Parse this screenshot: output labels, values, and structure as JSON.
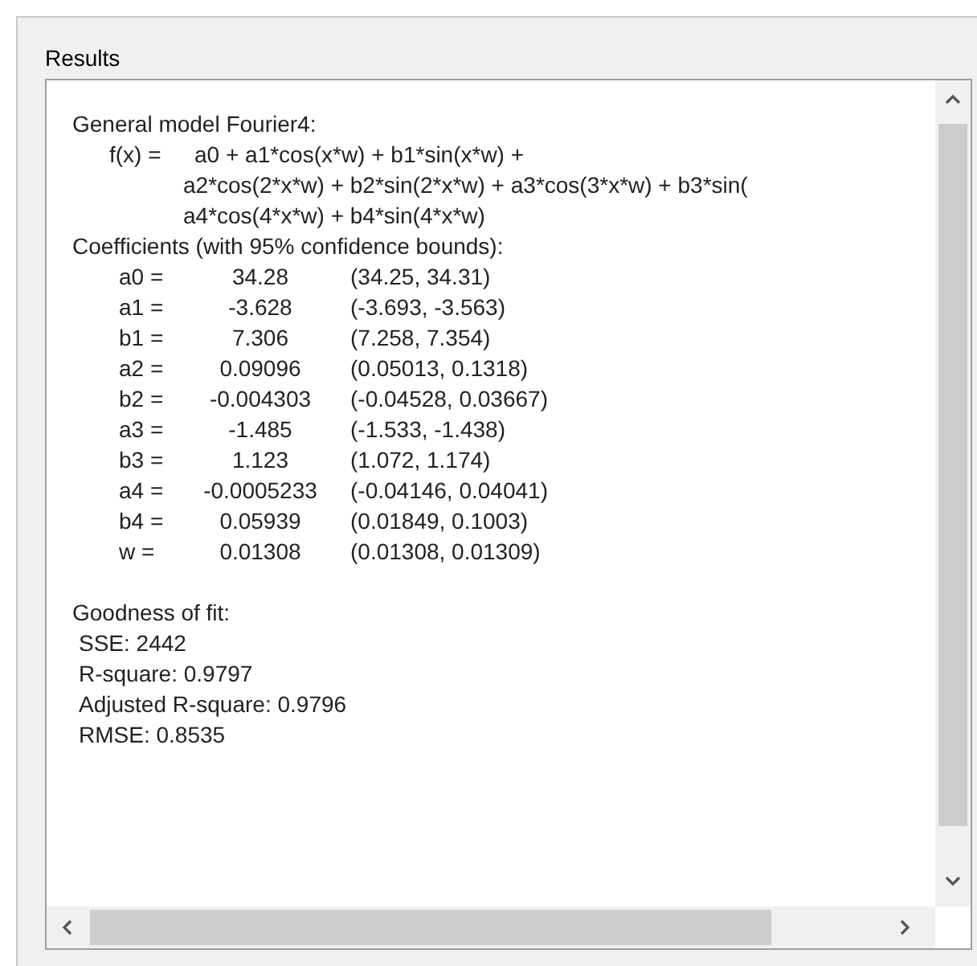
{
  "panel": {
    "title": "Results"
  },
  "results": {
    "model_heading": "General model Fourier4:",
    "formula_lhs": "f(x) =",
    "formula_lines": [
      "a0 + a1*cos(x*w) + b1*sin(x*w) +",
      "a2*cos(2*x*w) + b2*sin(2*x*w) + a3*cos(3*x*w) + b3*sin(",
      "a4*cos(4*x*w) + b4*sin(4*x*w)"
    ],
    "coefficients_heading": "Coefficients (with 95% confidence bounds):",
    "coefficients": [
      {
        "name": "a0 =",
        "value": "34.28",
        "bounds": "(34.25, 34.31)"
      },
      {
        "name": "a1 =",
        "value": "-3.628",
        "bounds": "(-3.693, -3.563)"
      },
      {
        "name": "b1 =",
        "value": "7.306",
        "bounds": "(7.258, 7.354)"
      },
      {
        "name": "a2 =",
        "value": "0.09096",
        "bounds": "(0.05013, 0.1318)"
      },
      {
        "name": "b2 =",
        "value": "-0.004303",
        "bounds": "(-0.04528, 0.03667)"
      },
      {
        "name": "a3 =",
        "value": "-1.485",
        "bounds": "(-1.533, -1.438)"
      },
      {
        "name": "b3 =",
        "value": "1.123",
        "bounds": "(1.072, 1.174)"
      },
      {
        "name": "a4 =",
        "value": "-0.0005233",
        "bounds": "(-0.04146, 0.04041)"
      },
      {
        "name": "b4 =",
        "value": "0.05939",
        "bounds": "(0.01849, 0.1003)"
      },
      {
        "name": "w =",
        "value": "0.01308",
        "bounds": "(0.01308, 0.01309)"
      }
    ],
    "goodness_heading": "Goodness of fit:",
    "goodness": [
      "SSE: 2442",
      "R-square: 0.9797",
      "Adjusted R-square: 0.9796",
      "RMSE: 0.8535"
    ]
  }
}
